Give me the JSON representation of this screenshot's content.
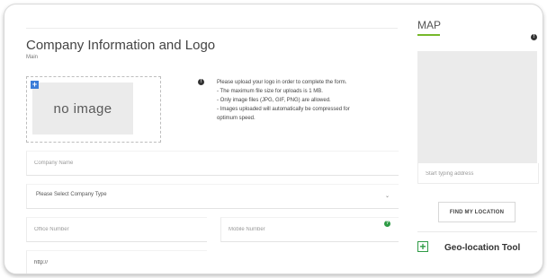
{
  "form": {
    "title": "Company Information and Logo",
    "subtitle": "Main",
    "logo_placeholder": "no image",
    "upload_info": [
      "Please upload your logo in order to complete the form.",
      "- The maximum file size for uploads is 1 MB.",
      "- Only image files (JPG, GIF, PNG) are allowed.",
      "- Images uploaded will automatically be compressed for",
      "optimum speed."
    ],
    "company_name_placeholder": "Company Name",
    "company_type_selected": "Please Select Company Type",
    "office_number_placeholder": "Office Number",
    "mobile_number_placeholder": "Mobile Number",
    "website_value": "http://"
  },
  "map": {
    "title": "MAP",
    "address_placeholder": "Start typing address",
    "find_button_label": "FIND MY LOCATION",
    "geo_tool_label": "Geo-location Tool"
  },
  "colors": {
    "accent_green": "#76b82a",
    "help_green": "#2e9b45",
    "upload_blue": "#3b7dd8"
  },
  "icons": {
    "upload": "plus-icon",
    "info": "info-icon",
    "help": "help-icon",
    "select": "chevron-down-icon",
    "geo": "plus-icon"
  }
}
